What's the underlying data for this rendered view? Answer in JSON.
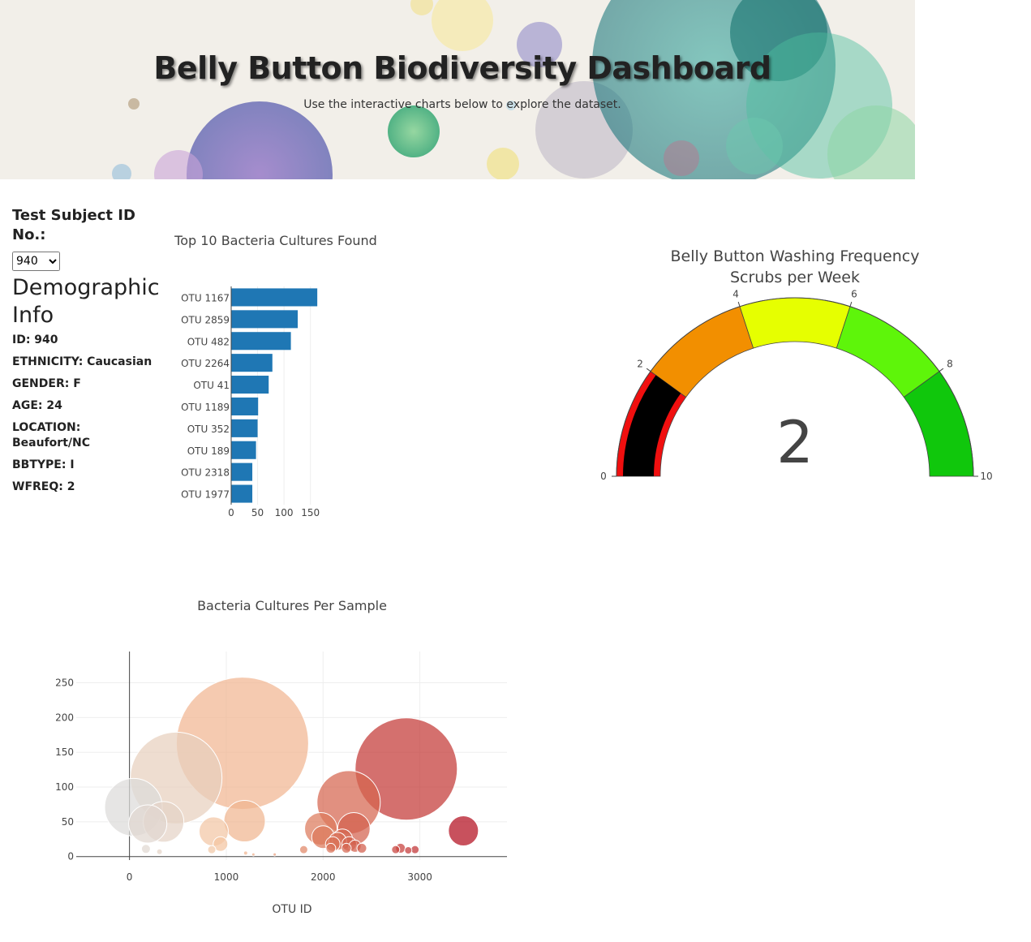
{
  "header": {
    "title": "Belly Button Biodiversity Dashboard",
    "subtitle": "Use the interactive charts below to explore the dataset."
  },
  "sidebar": {
    "select_label": "Test Subject ID No.:",
    "selected_id": "940",
    "demo_title": "Demographic Info",
    "demographics": [
      {
        "label": "ID: 940"
      },
      {
        "label": "ETHNICITY: Caucasian"
      },
      {
        "label": "GENDER: F"
      },
      {
        "label": "AGE: 24"
      },
      {
        "label": "LOCATION: Beaufort/NC"
      },
      {
        "label": "BBTYPE: I"
      },
      {
        "label": "WFREQ: 2"
      }
    ]
  },
  "colors": {
    "bar": "#1f77b4",
    "gauge_steps": [
      "#f00f0f",
      "#f28f00",
      "#e6ff00",
      "#5ef50a",
      "#10c70c"
    ],
    "gauge_bar": "#000000"
  },
  "chart_data": [
    {
      "type": "bar",
      "orientation": "horizontal",
      "title": "Top 10 Bacteria Cultures Found",
      "categories": [
        "OTU 1167",
        "OTU 2859",
        "OTU 482",
        "OTU 2264",
        "OTU 41",
        "OTU 1189",
        "OTU 352",
        "OTU 189",
        "OTU 2318",
        "OTU 1977"
      ],
      "values": [
        163,
        126,
        113,
        78,
        71,
        51,
        50,
        47,
        40,
        40
      ],
      "xticks": [
        0,
        50,
        100,
        150
      ],
      "xlim": [
        0,
        172
      ]
    },
    {
      "type": "gauge",
      "title": "Belly Button Washing Frequency",
      "subtitle": "Scrubs per Week",
      "value": 2,
      "range": [
        0,
        10
      ],
      "steps": [
        [
          0,
          2
        ],
        [
          2,
          4
        ],
        [
          4,
          6
        ],
        [
          6,
          8
        ],
        [
          8,
          10
        ]
      ],
      "ticks": [
        0,
        2,
        4,
        6,
        8,
        10
      ]
    },
    {
      "type": "scatter",
      "title": "Bacteria Cultures Per Sample",
      "xlabel": "OTU ID",
      "ylabel": "",
      "xlim": [
        -550,
        3900
      ],
      "ylim": [
        -5,
        295
      ],
      "xticks": [
        0,
        1000,
        2000,
        3000
      ],
      "yticks": [
        0,
        50,
        100,
        150,
        200,
        250
      ],
      "points": [
        {
          "x": 41,
          "y": 71
        },
        {
          "x": 189,
          "y": 47
        },
        {
          "x": 352,
          "y": 50
        },
        {
          "x": 482,
          "y": 113
        },
        {
          "x": 1167,
          "y": 163
        },
        {
          "x": 1189,
          "y": 51
        },
        {
          "x": 870,
          "y": 36
        },
        {
          "x": 940,
          "y": 18
        },
        {
          "x": 2264,
          "y": 78
        },
        {
          "x": 2859,
          "y": 126
        },
        {
          "x": 3450,
          "y": 37
        },
        {
          "x": 1977,
          "y": 40
        },
        {
          "x": 2318,
          "y": 40
        },
        {
          "x": 2000,
          "y": 28
        },
        {
          "x": 2100,
          "y": 18
        },
        {
          "x": 2200,
          "y": 25
        },
        {
          "x": 2240,
          "y": 12
        },
        {
          "x": 2270,
          "y": 18
        },
        {
          "x": 2330,
          "y": 15
        },
        {
          "x": 2400,
          "y": 12
        },
        {
          "x": 2080,
          "y": 12
        },
        {
          "x": 2150,
          "y": 22
        },
        {
          "x": 1800,
          "y": 10
        },
        {
          "x": 2750,
          "y": 10
        },
        {
          "x": 2800,
          "y": 12
        },
        {
          "x": 2880,
          "y": 9
        },
        {
          "x": 2950,
          "y": 10
        },
        {
          "x": 170,
          "y": 11
        },
        {
          "x": 310,
          "y": 7
        },
        {
          "x": 850,
          "y": 10
        },
        {
          "x": 1200,
          "y": 5
        },
        {
          "x": 1280,
          "y": 3
        },
        {
          "x": 1500,
          "y": 3
        }
      ]
    }
  ]
}
